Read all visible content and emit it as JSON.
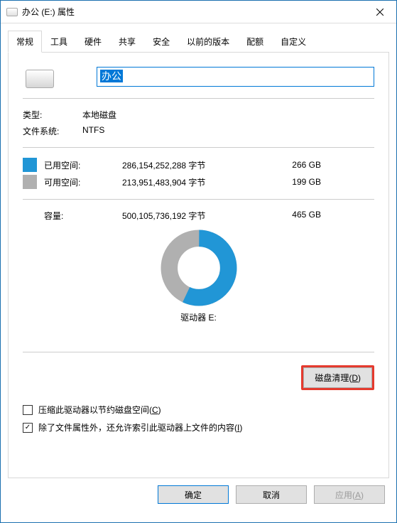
{
  "window": {
    "title": "办公 (E:) 属性"
  },
  "tabs": [
    "常规",
    "工具",
    "硬件",
    "共享",
    "安全",
    "以前的版本",
    "配额",
    "自定义"
  ],
  "activeTab": 0,
  "general": {
    "driveName": "办公",
    "typeLabel": "类型:",
    "typeValue": "本地磁盘",
    "fsLabel": "文件系统:",
    "fsValue": "NTFS",
    "usedLabel": "已用空间:",
    "usedBytes": "286,154,252,288 字节",
    "usedGB": "266 GB",
    "freeLabel": "可用空间:",
    "freeBytes": "213,951,483,904 字节",
    "freeGB": "199 GB",
    "capLabel": "容量:",
    "capBytes": "500,105,736,192 字节",
    "capGB": "465 GB",
    "driveLabel": "驱动器 E:",
    "cleanupBtn": "磁盘清理(D)",
    "cleanupHotkey": "D",
    "compressLabel": "压缩此驱动器以节约磁盘空间(C)",
    "compressHotkey": "C",
    "compressChecked": false,
    "indexLabel": "除了文件属性外，还允许索引此驱动器上文件的内容(I)",
    "indexHotkey": "I",
    "indexChecked": true
  },
  "footer": {
    "ok": "确定",
    "cancel": "取消",
    "apply": "应用(A)",
    "applyHotkey": "A"
  },
  "colors": {
    "used": "#2196d6",
    "free": "#b0b0b0",
    "highlight": "#e53a2e"
  },
  "chart_data": {
    "type": "pie",
    "title": "驱动器 E:",
    "series": [
      {
        "name": "已用空间",
        "value": 266,
        "unit": "GB",
        "color": "#2196d6"
      },
      {
        "name": "可用空间",
        "value": 199,
        "unit": "GB",
        "color": "#b0b0b0"
      }
    ],
    "total": {
      "label": "容量",
      "value": 465,
      "unit": "GB"
    }
  }
}
